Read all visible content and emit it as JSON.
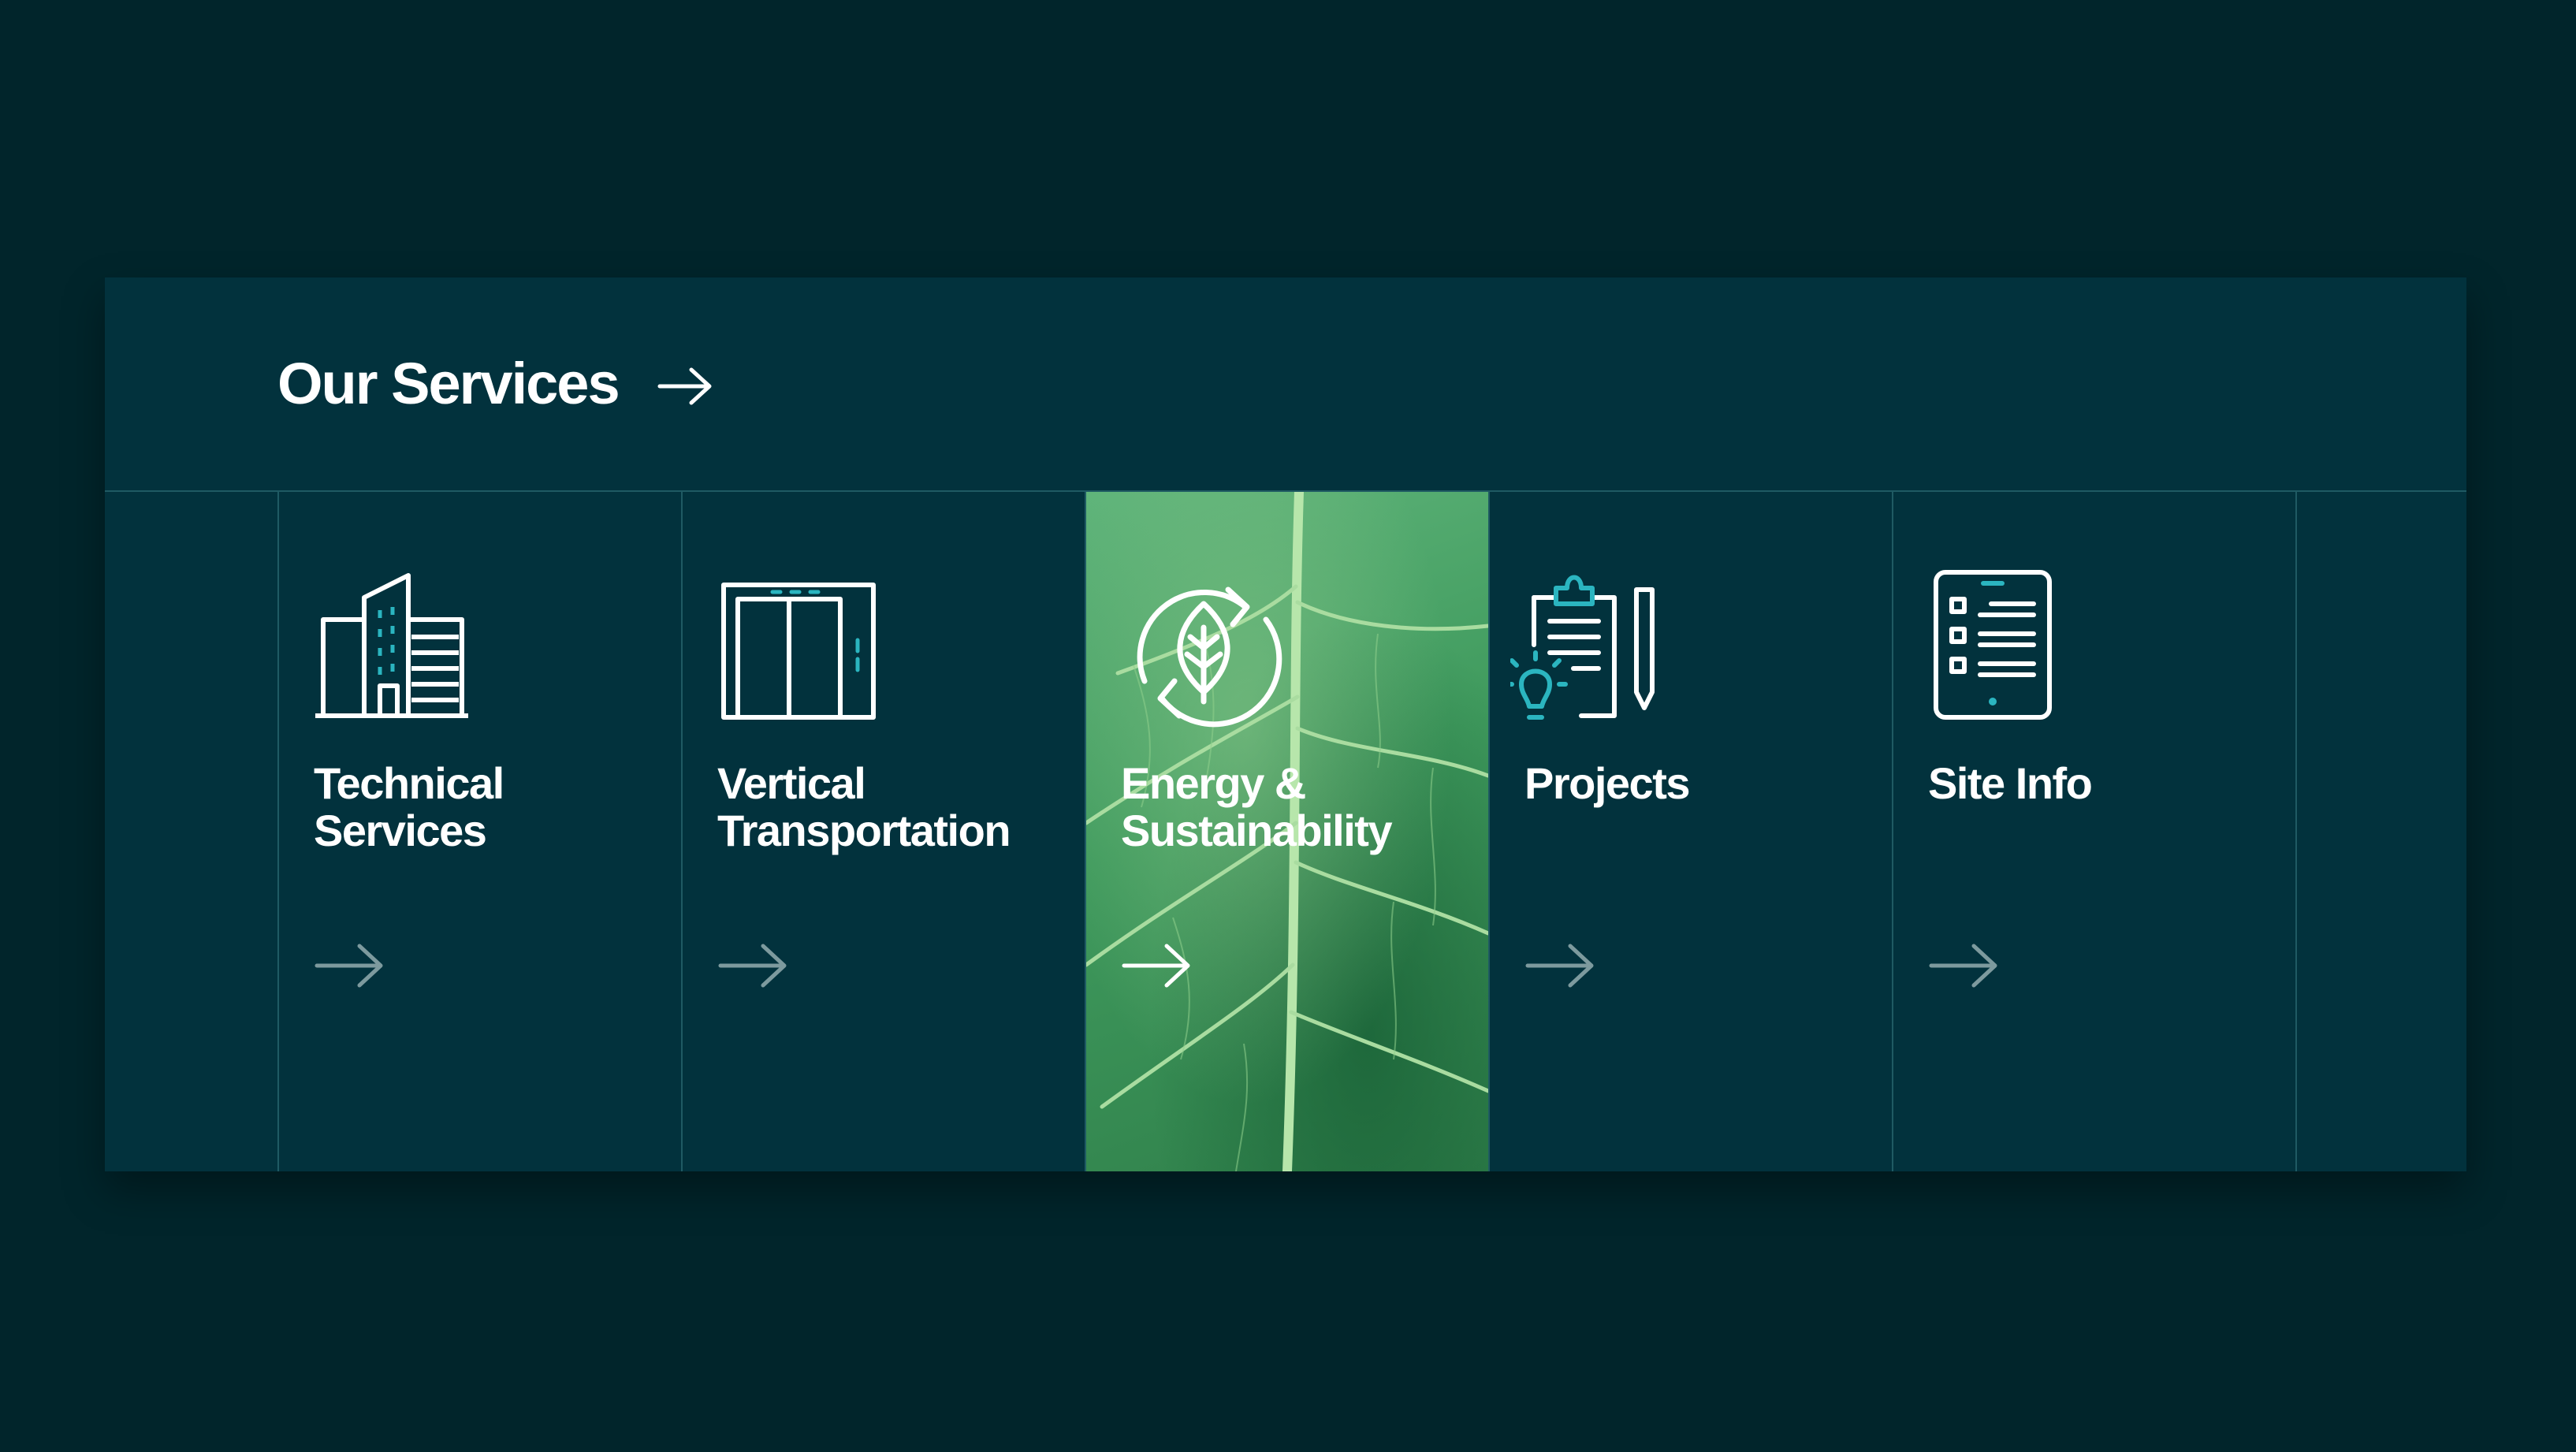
{
  "colors": {
    "page_bg": "#01252b",
    "panel_bg": "#02323d",
    "divider": "#1f5a63",
    "text": "#ffffff",
    "icon_accent": "#2bb5c0",
    "arrow_muted": "#7d9a9e"
  },
  "services": {
    "title": "Our Services",
    "title_arrow_icon": "arrow-right-icon",
    "cards": [
      {
        "label": "Technical\nServices",
        "icon": "building-icon"
      },
      {
        "label": "Vertical\nTransportation",
        "icon": "elevator-icon"
      },
      {
        "label": "Energy &\nSustainability",
        "icon": "leaf-cycle-icon"
      },
      {
        "label": "Projects",
        "icon": "clipboard-lightbulb-icon"
      },
      {
        "label": "Site Info",
        "icon": "tablet-checklist-icon"
      }
    ]
  }
}
